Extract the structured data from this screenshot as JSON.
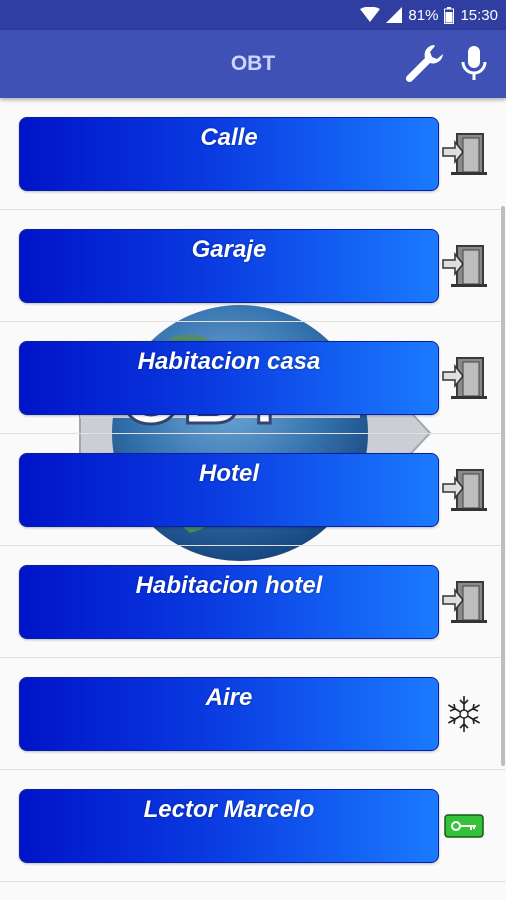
{
  "status": {
    "battery": "81%",
    "time": "15:30",
    "icons": [
      "wifi-icon",
      "signal-icon",
      "battery-icon"
    ]
  },
  "app_bar": {
    "title": "OBT",
    "actions": [
      "wrench-icon",
      "microphone-icon"
    ]
  },
  "colors": {
    "status_bar": "#2f3ea0",
    "app_bar": "#3f51b5",
    "button_gradient_start": "#0014c8",
    "button_gradient_end": "#1a7aff"
  },
  "items": [
    {
      "label": "Calle",
      "icon": "door-exit-icon"
    },
    {
      "label": "Garaje",
      "icon": "door-exit-icon"
    },
    {
      "label": "Habitacion casa",
      "icon": "door-exit-icon"
    },
    {
      "label": "Hotel",
      "icon": "door-exit-icon"
    },
    {
      "label": "Habitacion hotel",
      "icon": "door-exit-icon"
    },
    {
      "label": "Aire",
      "icon": "snowflake-icon"
    },
    {
      "label": "Lector Marcelo",
      "icon": "key-card-icon"
    }
  ]
}
